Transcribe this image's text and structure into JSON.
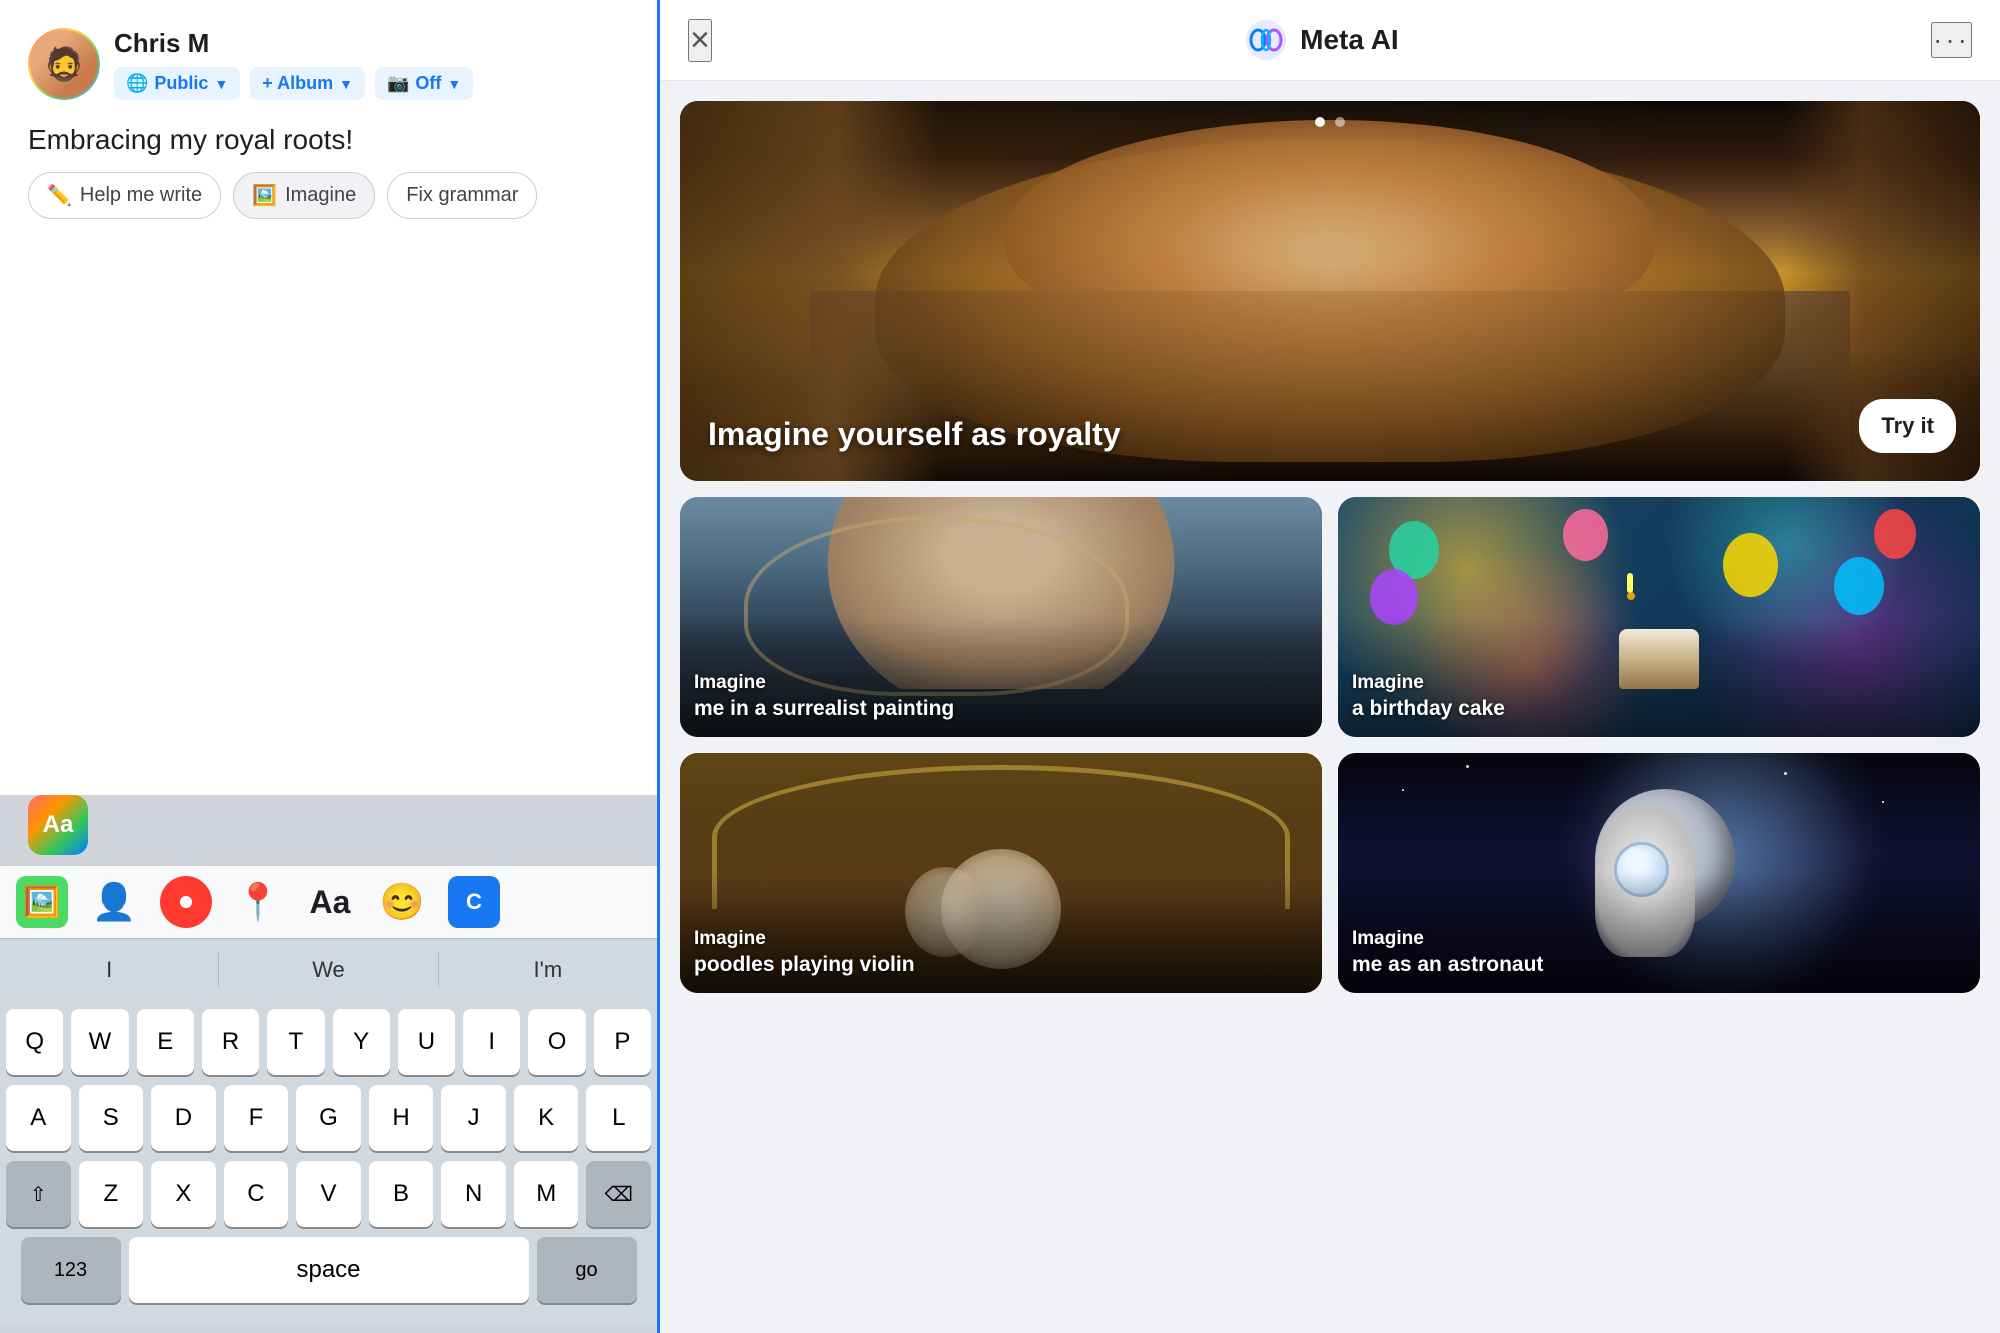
{
  "left": {
    "user": {
      "name": "Chris M",
      "avatar_emoji": "👤"
    },
    "privacy": {
      "label": "Public",
      "album_label": "+ Album",
      "off_label": "Off"
    },
    "post_text": "Embracing my royal roots!",
    "ai_buttons": [
      {
        "id": "help-write",
        "icon": "✏️",
        "label": "Help me write"
      },
      {
        "id": "imagine",
        "icon": "🖼️",
        "label": "Imagine"
      },
      {
        "id": "fix-grammar",
        "icon": "",
        "label": "Fix grammar"
      }
    ],
    "keyboard": {
      "suggestions": [
        "I",
        "We",
        "I'm"
      ],
      "rows": [
        [
          "Q",
          "W",
          "E",
          "R",
          "T",
          "Y",
          "U",
          "I",
          "O",
          "P"
        ],
        [
          "A",
          "S",
          "D",
          "F",
          "G",
          "H",
          "J",
          "K",
          "L"
        ],
        [
          "Z",
          "X",
          "C",
          "V",
          "B",
          "N",
          "M"
        ]
      ],
      "bottom": [
        "123",
        "space",
        "go"
      ],
      "toolbar_icons": [
        "📷",
        "👤",
        "📹",
        "📍",
        "Aa",
        "😊"
      ]
    },
    "aa_label": "Aa"
  },
  "right": {
    "header": {
      "close_label": "×",
      "title": "Meta AI",
      "more_label": "···"
    },
    "hero": {
      "text": "Imagine yourself as royalty",
      "try_it_label": "Try it",
      "dots": [
        true,
        false
      ]
    },
    "cards": [
      {
        "id": "surrealist",
        "prefix": "Imagine",
        "main": "me in a surrealist painting"
      },
      {
        "id": "birthday",
        "prefix": "Imagine",
        "main": "a birthday cake"
      },
      {
        "id": "poodle",
        "prefix": "Imagine",
        "main": "poodles playing violin"
      },
      {
        "id": "astronaut",
        "prefix": "Imagine",
        "main": "me as an astronaut"
      }
    ]
  }
}
